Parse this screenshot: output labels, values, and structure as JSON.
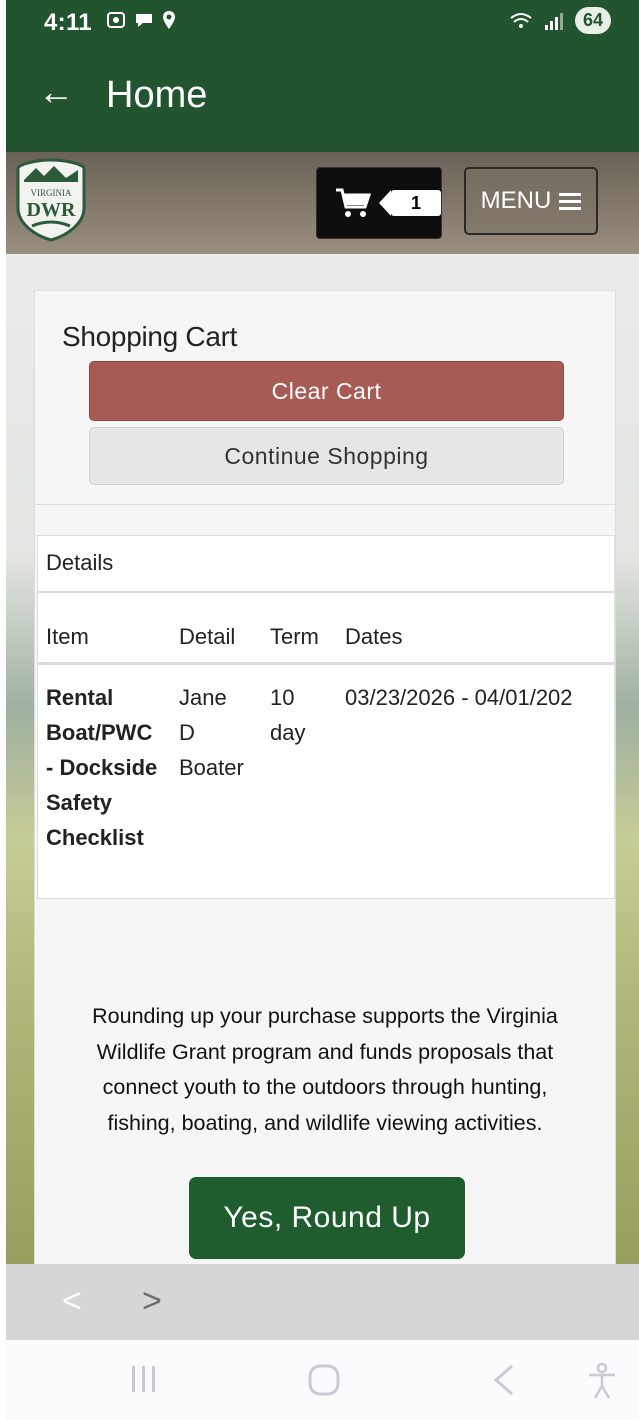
{
  "status_bar": {
    "time": "4:11",
    "left_icons": [
      "screenshot-icon",
      "chat-icon",
      "location-icon"
    ],
    "right_icons": [
      "wifi-icon",
      "signal-icon"
    ],
    "battery": "64"
  },
  "app_bar": {
    "title": "Home"
  },
  "header": {
    "logo_text_top": "VIRGINIA",
    "logo_text_main": "DWR",
    "cart_count": "1",
    "menu_label": "MENU"
  },
  "cart": {
    "title": "Shopping Cart",
    "clear_label": "Clear Cart",
    "continue_label": "Continue Shopping"
  },
  "details": {
    "title": "Details",
    "columns": [
      "Item",
      "Detail",
      "Term",
      "Dates"
    ],
    "rows": [
      {
        "item": "Rental\nBoat/PWC\n- Dockside\nSafety\nChecklist",
        "detail": "Jane\nD\nBoater",
        "term": "10\nday",
        "dates": "03/23/2026 - 04/01/202"
      }
    ]
  },
  "roundup": {
    "text": "Rounding up your purchase supports the Virginia Wildlife Grant program and funds proposals that connect youth to the outdoors through hunting, fishing, boating, and wildlife viewing activities.",
    "button_label": "Yes, Round Up"
  },
  "browser_nav": {
    "prev": "<",
    "next": ">"
  },
  "colors": {
    "brand_green": "#22552f",
    "clear_red": "#a85b54",
    "roundup_green": "#1f5c2e"
  }
}
